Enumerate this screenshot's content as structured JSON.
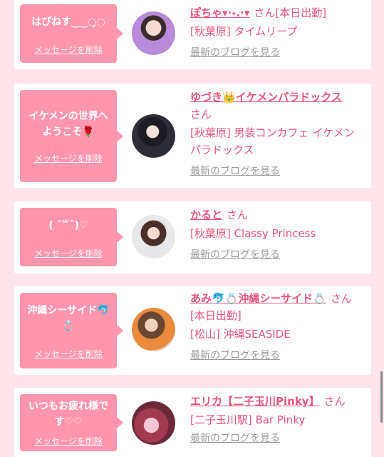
{
  "delete_label": "メッセージを削除",
  "blog_label": "最新のブログを見る",
  "san": "さん",
  "colors": {
    "accent": "#e8557a",
    "bubble": "#ff96ad",
    "background": "#ffe4ec"
  },
  "cards": [
    {
      "message": "はぴねす‿‿◌̥◌",
      "name": "ぽちゃ▾·˖.·▾",
      "name_suffix": "[本日出勤]",
      "shop": "[秋葉原] タイムリープ"
    },
    {
      "message": "イケメンの世界へようこそ🌹",
      "name": "ゆづき👑イケメンパラドックス",
      "name_suffix": "",
      "shop": "[秋葉原] 男装コンカフェ イケメンパラドックス"
    },
    {
      "message": "( ˆ꒳ˆ)♡",
      "name": "かると",
      "name_suffix": "",
      "shop": "[秋葉原] Classy Princess"
    },
    {
      "message": "沖縄シーサイド🐬💍",
      "name": "あみ🐬💍沖縄シーサイド💍",
      "name_suffix": "[本日出勤]",
      "shop": "[松山] 沖縄SEASIDE"
    },
    {
      "message": "いつもお疲れ様です♡♡",
      "name": "エリカ【二子玉川Pinky】",
      "name_suffix": "",
      "shop": "[二子玉川駅] Bar Pinky"
    }
  ]
}
